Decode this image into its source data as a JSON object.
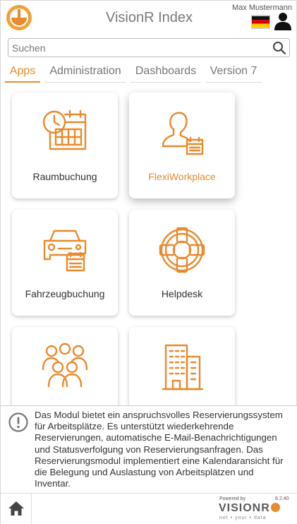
{
  "header": {
    "title": "VisionR Index",
    "user_name": "Max Mustermann",
    "logo_icon": "visionr-logo",
    "flag_icon": "german-flag-icon",
    "user_icon": "user-icon"
  },
  "search": {
    "placeholder": "Suchen",
    "value": ""
  },
  "tabs": [
    {
      "label": "Apps",
      "active": true
    },
    {
      "label": "Administration",
      "active": false
    },
    {
      "label": "Dashboards",
      "active": false
    },
    {
      "label": "Version 7",
      "active": false
    }
  ],
  "tiles": [
    {
      "label": "Raumbuchung",
      "icon": "room-booking-icon",
      "highlighted": false
    },
    {
      "label": "FlexiWorkplace",
      "icon": "flexi-workplace-icon",
      "highlighted": true
    },
    {
      "label": "Fahrzeugbuchung",
      "icon": "car-booking-icon",
      "highlighted": false
    },
    {
      "label": "Helpdesk",
      "icon": "lifebuoy-icon",
      "highlighted": false
    },
    {
      "label": "",
      "icon": "group-icon",
      "highlighted": false
    },
    {
      "label": "",
      "icon": "building-icon",
      "highlighted": false
    }
  ],
  "info": {
    "icon": "info-icon",
    "text": "Das Modul bietet ein anspruchsvolles Reservierungssystem für Arbeitsplätze. Es unterstützt wiederkehrende Reservierungen, automatische E-Mail-Benachrichtigungen und Statusverfolgung von Reservierungsanfragen. Das Reservierungsmodul implementiert eine Kalendaransicht für die Belegung und Auslastung von Arbeitsplätzen und Inventar."
  },
  "footer": {
    "home_icon": "home-icon",
    "powered_by": "Powered by",
    "version": "8.2.40",
    "brand": "VISIONR",
    "tagline": "net • your • data"
  },
  "colors": {
    "accent": "#e88a2e",
    "text": "#333333",
    "muted": "#777777"
  }
}
